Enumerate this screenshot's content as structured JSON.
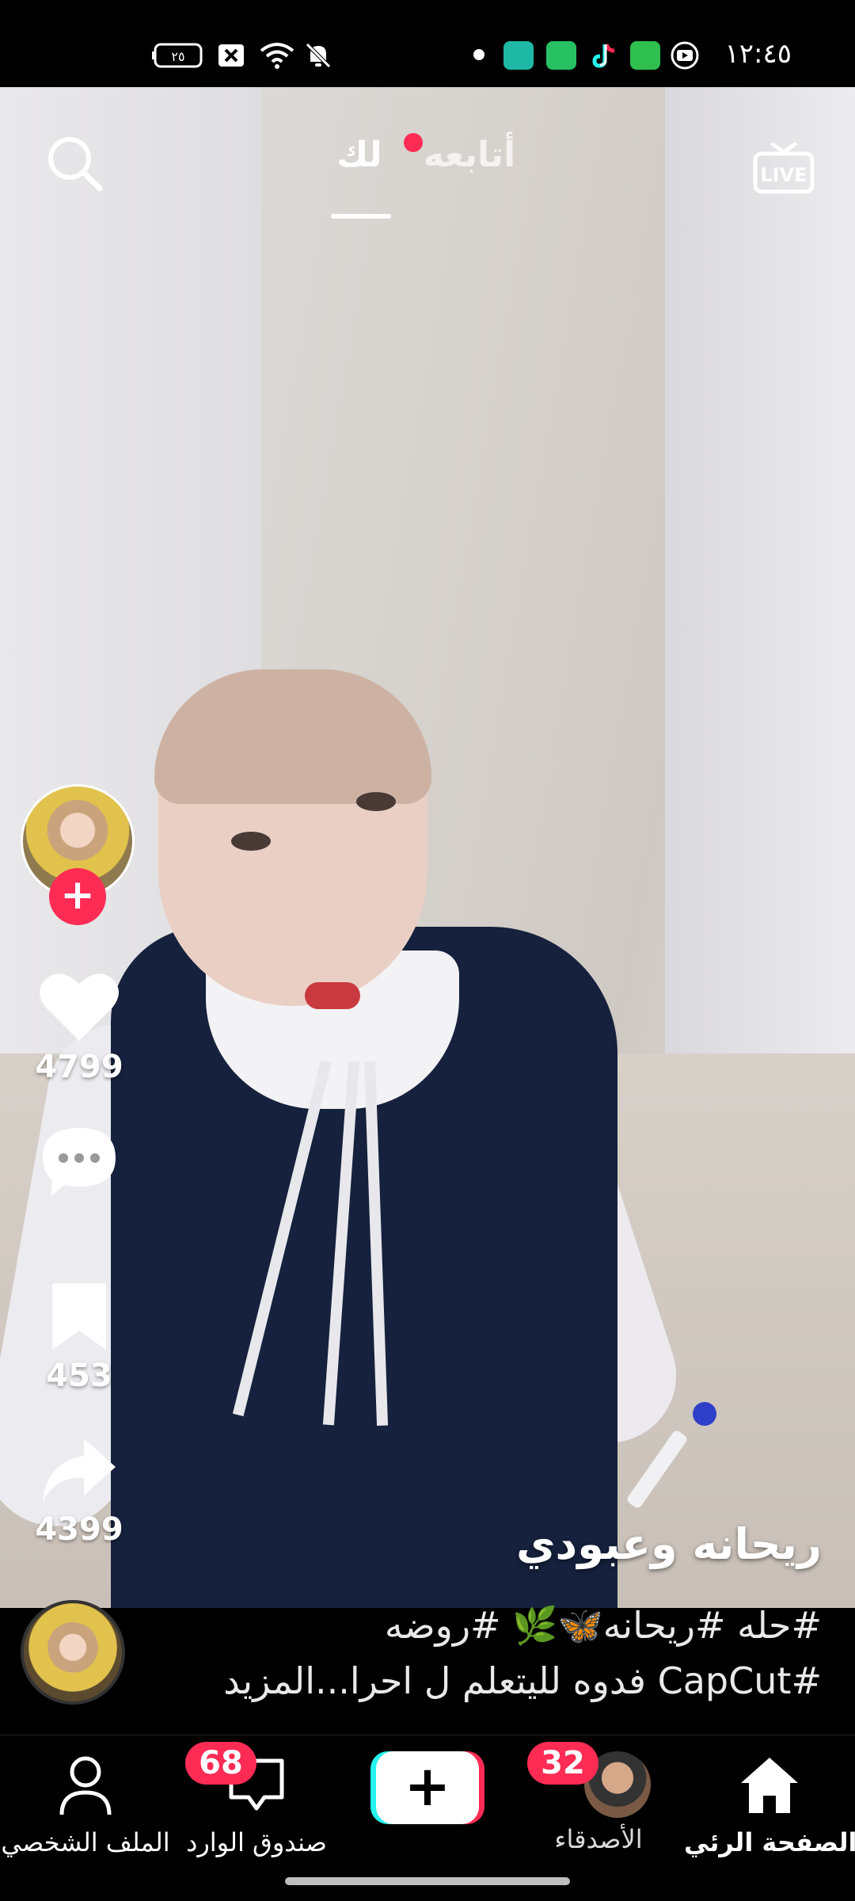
{
  "status_bar": {
    "time": "١٢:٤٥",
    "battery": "٢٥",
    "icons": [
      "battery-icon",
      "close-box-icon",
      "wifi-icon",
      "mute-bell-icon",
      "dot-icon",
      "chat-app-icon",
      "clipboard-app-icon",
      "tiktok-app-icon",
      "phone-app-icon",
      "youtube-app-icon"
    ]
  },
  "top_nav": {
    "following_tab": "أتابعه",
    "for_you_tab": "لك",
    "active_tab": "for_you",
    "notification_dot_color": "#fe2c55",
    "live_label": "LIVE"
  },
  "actions": {
    "likes": "4799",
    "comments": "",
    "bookmarks": "453",
    "shares": "4399",
    "follow_symbol": "+"
  },
  "video": {
    "author": "ريحانه وعبودي",
    "caption_line1": "#حله #ريحانه🦋🌿 #روضه",
    "caption_line2": "#CapCut فدوه لليتعلم ل احرا...المزيد"
  },
  "bottom_nav": {
    "home": "الصفحة الرئي...",
    "friends": "الأصدقاء",
    "friends_badge": "32",
    "create_symbol": "+",
    "inbox": "صندوق الوارد",
    "inbox_badge": "68",
    "profile": "الملف الشخصي"
  },
  "colors": {
    "accent": "#fe2c55",
    "cyan": "#25f4ee",
    "background": "#000000"
  }
}
